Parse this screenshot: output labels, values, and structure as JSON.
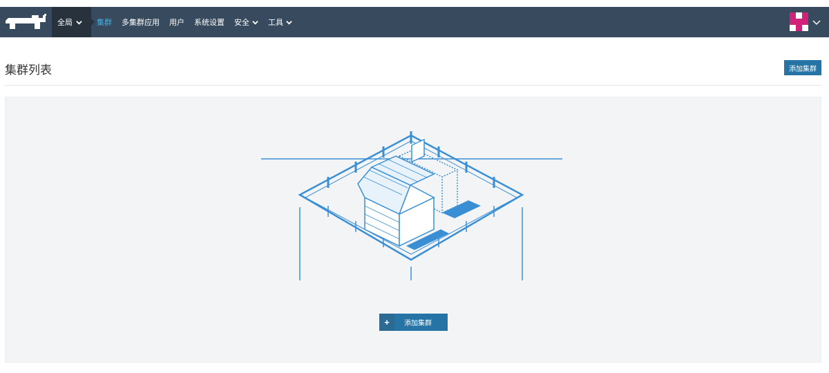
{
  "nav": {
    "scope_label": "全局",
    "items": [
      {
        "label": "集群",
        "active": true,
        "dropdown": false
      },
      {
        "label": "多集群应用",
        "active": false,
        "dropdown": false
      },
      {
        "label": "用户",
        "active": false,
        "dropdown": false
      },
      {
        "label": "系统设置",
        "active": false,
        "dropdown": false
      },
      {
        "label": "安全",
        "active": false,
        "dropdown": true
      },
      {
        "label": "工具",
        "active": false,
        "dropdown": true
      }
    ]
  },
  "header": {
    "title": "集群列表",
    "add_button_label": "添加集群"
  },
  "empty_state": {
    "add_button_label": "添加集群"
  },
  "colors": {
    "nav_bg": "#374a5e",
    "scope_bg": "#27323d",
    "active_link": "#3fb1e8",
    "primary_button": "#2574a5",
    "avatar_pink": "#d1217a",
    "illustration_blue": "#3a8fd4"
  },
  "icons": [
    "rancher-logo",
    "chevron-down-icon",
    "avatar-identicon",
    "plus-icon",
    "farm-illustration"
  ]
}
